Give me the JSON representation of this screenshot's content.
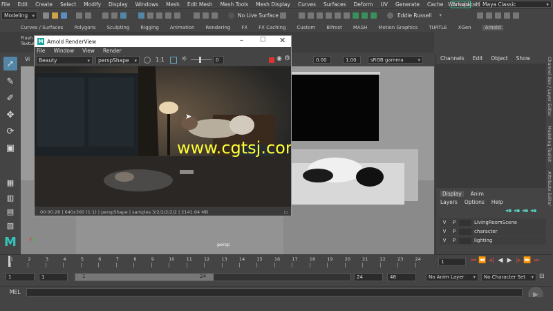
{
  "menubar": {
    "items": [
      "File",
      "Edit",
      "Create",
      "Select",
      "Modify",
      "Display",
      "Windows",
      "Mesh",
      "Edit Mesh",
      "Mesh Tools",
      "Mesh Display",
      "Curves",
      "Surfaces",
      "Deform",
      "UV",
      "Generate",
      "Cache"
    ],
    "arnold": "Arnold",
    "help": "Help",
    "workspace_label": "Workspace :",
    "workspace_value": "Maya Classic"
  },
  "statusline": {
    "mode": "Modeling",
    "live_surface": "No Live Surface",
    "user": "Eddie Russell"
  },
  "shelf_tabs": [
    "Curves / Surfaces",
    "Polygons",
    "Sculpting",
    "Rigging",
    "Animation",
    "Rendering",
    "FX",
    "FX Caching",
    "Custom",
    "Bifrost",
    "MASH",
    "Motion Graphics",
    "TURTLE",
    "XGen",
    "Arnold"
  ],
  "shelf_left": {
    "line1": "Flush",
    "line2": "Texture"
  },
  "viewport": {
    "exposure": "0.00",
    "gamma": "1.00",
    "color_space": "sRGB gamma",
    "camera_label": "persp",
    "corner_label": "Vi"
  },
  "renderview": {
    "title": "Arnold RenderView",
    "menu": [
      "File",
      "Window",
      "View",
      "Render"
    ],
    "aov": "Beauty",
    "camera": "perspShape",
    "ratio": "1:1",
    "slider_value": "0",
    "status": "00:00:28 | 640x360 (1:1) | perspShape | samples 3/2/2/2/2/2 | 2141.64 MB"
  },
  "watermark": "www.cgtsj.com",
  "channel_box": {
    "menu": [
      "Channels",
      "Edit",
      "Object",
      "Show"
    ],
    "tabs": [
      "Display",
      "Anim"
    ],
    "submenu": [
      "Layers",
      "Options",
      "Help"
    ],
    "layers": [
      {
        "v": "V",
        "p": "P",
        "name": "LivingRoomScene"
      },
      {
        "v": "V",
        "p": "P",
        "name": "character"
      },
      {
        "v": "V",
        "p": "P",
        "name": "lighting"
      }
    ],
    "side_tabs": [
      "Channel Box / Layer Editor",
      "Modeling Toolkit",
      "Attribute Editor"
    ]
  },
  "timeslider": {
    "ticks": [
      "1",
      "2",
      "3",
      "4",
      "5",
      "6",
      "7",
      "8",
      "9",
      "10",
      "11",
      "12",
      "13",
      "14",
      "15",
      "16",
      "17",
      "18",
      "19",
      "20",
      "21",
      "22",
      "23",
      "24"
    ],
    "current_frame": "1"
  },
  "range": {
    "start": "1",
    "inner_start": "1",
    "range_start_label": "1",
    "range_end_label": "24",
    "inner_end": "24",
    "end": "48",
    "anim_layer": "No Anim Layer",
    "char_set": "No Character Set"
  },
  "cmd": {
    "label": "MEL"
  },
  "colors": {
    "accent": "#5285a6",
    "arnold_green": "#33cc99",
    "watermark": "#ffff33"
  }
}
